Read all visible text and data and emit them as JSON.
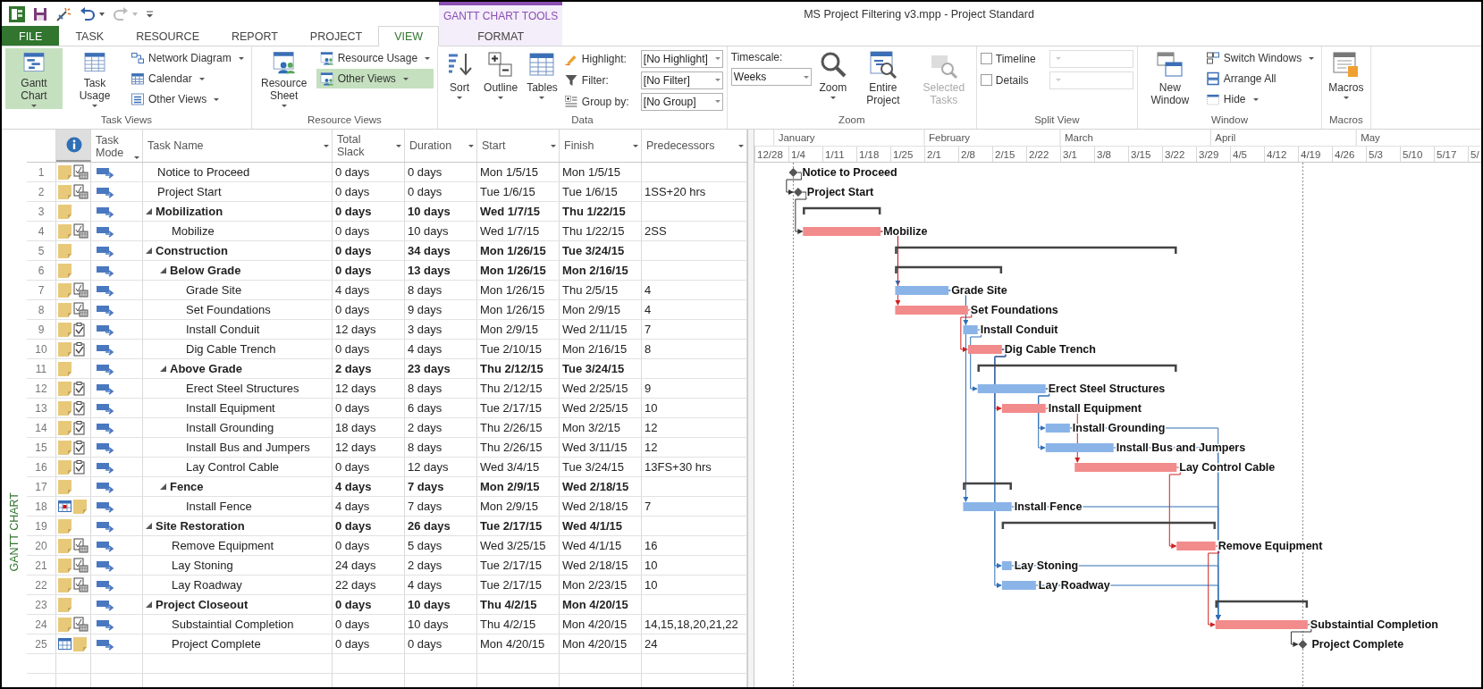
{
  "window": {
    "title": "MS Project Filtering v3.mpp - Project Standard"
  },
  "contextual_group": "GANTT CHART TOOLS",
  "tabs": [
    {
      "label": "FILE",
      "kind": "file",
      "selected": false
    },
    {
      "label": "TASK",
      "kind": "tab",
      "selected": false
    },
    {
      "label": "RESOURCE",
      "kind": "tab",
      "selected": false
    },
    {
      "label": "REPORT",
      "kind": "tab",
      "selected": false
    },
    {
      "label": "PROJECT",
      "kind": "tab",
      "selected": false
    },
    {
      "label": "VIEW",
      "kind": "tab",
      "selected": true
    },
    {
      "label": "FORMAT",
      "kind": "contextual",
      "selected": false
    }
  ],
  "ribbon": {
    "groups": [
      {
        "label": "Task Views",
        "items": [
          {
            "kind": "large",
            "label": "Gantt Chart",
            "dropdown": true,
            "selected": true
          },
          {
            "kind": "large",
            "label": "Task Usage",
            "dropdown": true,
            "selected": false
          },
          {
            "kind": "small",
            "label": "Network Diagram",
            "dropdown": true,
            "selected": false
          },
          {
            "kind": "small",
            "label": "Calendar",
            "dropdown": true,
            "selected": false
          },
          {
            "kind": "small",
            "label": "Other Views",
            "dropdown": true,
            "selected": false
          }
        ]
      },
      {
        "label": "Resource Views",
        "items": [
          {
            "kind": "large",
            "label": "Resource Sheet",
            "dropdown": true,
            "selected": false
          },
          {
            "kind": "small",
            "label": "Resource Usage",
            "dropdown": true,
            "selected": false
          },
          {
            "kind": "small",
            "label": "Other Views",
            "dropdown": true,
            "selected": true
          }
        ]
      },
      {
        "label": "Data",
        "items": [
          {
            "kind": "large",
            "label": "Sort",
            "dropdown": true
          },
          {
            "kind": "large",
            "label": "Outline",
            "dropdown": true
          },
          {
            "kind": "large",
            "label": "Tables",
            "dropdown": true
          },
          {
            "kind": "combo",
            "label": "Highlight:",
            "value": "[No Highlight]"
          },
          {
            "kind": "combo",
            "label": "Filter:",
            "value": "[No Filter]"
          },
          {
            "kind": "combo",
            "label": "Group by:",
            "value": "[No Group]"
          }
        ]
      },
      {
        "label": "Zoom",
        "items": [
          {
            "kind": "labeled-combo",
            "label": "Timescale:",
            "value": "Weeks",
            "disabled": false
          },
          {
            "kind": "large",
            "label": "Zoom",
            "dropdown": true,
            "disabled": false
          },
          {
            "kind": "large",
            "label": "Entire Project",
            "dropdown": false,
            "disabled": false
          },
          {
            "kind": "large",
            "label": "Selected Tasks",
            "dropdown": false,
            "disabled": true
          }
        ]
      },
      {
        "label": "Split View",
        "items": [
          {
            "kind": "checkbox",
            "label": "Timeline",
            "checked": false
          },
          {
            "kind": "checkbox",
            "label": "Details",
            "checked": false
          }
        ]
      },
      {
        "label": "Window",
        "items": [
          {
            "kind": "large",
            "label": "New Window",
            "dropdown": false
          },
          {
            "kind": "small",
            "label": "Switch Windows",
            "dropdown": true
          },
          {
            "kind": "small",
            "label": "Arrange All",
            "dropdown": false
          },
          {
            "kind": "small",
            "label": "Hide",
            "dropdown": true
          }
        ]
      },
      {
        "label": "Macros",
        "items": [
          {
            "kind": "large",
            "label": "Macros",
            "dropdown": true
          }
        ]
      }
    ]
  },
  "side_label": "GANTT CHART",
  "table": {
    "columns": [
      "Task Mode",
      "Task Name",
      "Total Slack",
      "Duration",
      "Start",
      "Finish",
      "Predecessors"
    ],
    "rows": [
      {
        "id": "1",
        "name": "Notice to Proceed",
        "kind": "milestone",
        "indicators": [
          {
            "kind": "note"
          },
          {
            "kind": "constraint-date"
          }
        ],
        "total_slack": "0 days",
        "duration": "0 days",
        "start": "Mon 1/5/15",
        "finish": "Mon 1/5/15",
        "bar_label": "Notice to Proceed"
      },
      {
        "id": "2",
        "name": "Project Start",
        "kind": "milestone",
        "indicators": [
          {
            "kind": "note"
          },
          {
            "kind": "constraint-date"
          }
        ],
        "total_slack": "0 days",
        "duration": "0 days",
        "start": "Tue 1/6/15",
        "finish": "Tue 1/6/15",
        "predecessors": "1SS+20 hrs",
        "bar_label": "Project Start"
      },
      {
        "id": "3",
        "name": "Mobilization",
        "kind": "summary",
        "indicators": [
          {
            "kind": "note"
          }
        ],
        "total_slack": "0 days",
        "duration": "10 days",
        "start": "Wed 1/7/15",
        "finish": "Thu 1/22/15",
        "children": [
          {
            "id": "4",
            "name": "Mobilize",
            "kind": "task",
            "critical": true,
            "indicators": [
              {
                "kind": "note"
              },
              {
                "kind": "constraint-date"
              }
            ],
            "total_slack": "0 days",
            "duration": "10 days",
            "start": "Wed 1/7/15",
            "finish": "Thu 1/22/15",
            "predecessors": "2SS",
            "bar_label": "Mobilize"
          }
        ]
      },
      {
        "id": "5",
        "name": "Construction",
        "kind": "summary",
        "indicators": [
          {
            "kind": "note"
          }
        ],
        "total_slack": "0 days",
        "duration": "34 days",
        "start": "Mon 1/26/15",
        "finish": "Tue 3/24/15",
        "children": [
          {
            "id": "6",
            "name": "Below Grade",
            "kind": "summary",
            "indicators": [
              {
                "kind": "note"
              }
            ],
            "total_slack": "0 days",
            "duration": "13 days",
            "start": "Mon 1/26/15",
            "finish": "Mon 2/16/15",
            "children": [
              {
                "id": "7",
                "name": "Grade Site",
                "kind": "task",
                "critical": false,
                "indicators": [
                  {
                    "kind": "note"
                  },
                  {
                    "kind": "constraint-date"
                  }
                ],
                "total_slack": "4 days",
                "duration": "8 days",
                "start": "Mon 1/26/15",
                "finish": "Thu 2/5/15",
                "predecessors": "4",
                "bar_label": "Grade Site"
              },
              {
                "id": "8",
                "name": "Set Foundations",
                "kind": "task",
                "critical": true,
                "indicators": [
                  {
                    "kind": "note"
                  },
                  {
                    "kind": "constraint-date"
                  }
                ],
                "total_slack": "0 days",
                "duration": "9 days",
                "start": "Mon 1/26/15",
                "finish": "Mon 2/9/15",
                "predecessors": "4",
                "bar_label": "Set Foundations"
              },
              {
                "id": "9",
                "name": "Install Conduit",
                "kind": "task",
                "critical": false,
                "indicators": [
                  {
                    "kind": "note"
                  },
                  {
                    "kind": "constraint"
                  }
                ],
                "total_slack": "12 days",
                "duration": "3 days",
                "start": "Mon 2/9/15",
                "finish": "Wed 2/11/15",
                "predecessors": "7",
                "bar_label": "Install Conduit"
              },
              {
                "id": "10",
                "name": "Dig Cable Trench",
                "kind": "task",
                "critical": true,
                "indicators": [
                  {
                    "kind": "note"
                  },
                  {
                    "kind": "constraint"
                  }
                ],
                "total_slack": "0 days",
                "duration": "4 days",
                "start": "Tue 2/10/15",
                "finish": "Mon 2/16/15",
                "predecessors": "8",
                "bar_label": "Dig Cable Trench"
              }
            ]
          },
          {
            "id": "11",
            "name": "Above Grade",
            "kind": "summary",
            "indicators": [
              {
                "kind": "note"
              }
            ],
            "total_slack": "2 days",
            "duration": "23 days",
            "start": "Thu 2/12/15",
            "finish": "Tue 3/24/15",
            "children": [
              {
                "id": "12",
                "name": "Erect Steel Structures",
                "kind": "task",
                "critical": false,
                "indicators": [
                  {
                    "kind": "note"
                  },
                  {
                    "kind": "constraint"
                  }
                ],
                "total_slack": "12 days",
                "duration": "8 days",
                "start": "Thu 2/12/15",
                "finish": "Wed 2/25/15",
                "predecessors": "9",
                "bar_label": "Erect Steel Structures"
              },
              {
                "id": "13",
                "name": "Install Equipment",
                "kind": "task",
                "critical": true,
                "indicators": [
                  {
                    "kind": "note"
                  },
                  {
                    "kind": "constraint"
                  }
                ],
                "total_slack": "0 days",
                "duration": "6 days",
                "start": "Tue 2/17/15",
                "finish": "Wed 2/25/15",
                "predecessors": "10",
                "bar_label": "Install Equipment"
              },
              {
                "id": "14",
                "name": "Install Grounding",
                "kind": "task",
                "critical": false,
                "indicators": [
                  {
                    "kind": "note"
                  },
                  {
                    "kind": "constraint"
                  }
                ],
                "total_slack": "18 days",
                "duration": "2 days",
                "start": "Thu 2/26/15",
                "finish": "Mon 3/2/15",
                "predecessors": "12",
                "bar_label": "Install Grounding"
              },
              {
                "id": "15",
                "name": "Install Bus and Jumpers",
                "kind": "task",
                "critical": false,
                "indicators": [
                  {
                    "kind": "note"
                  },
                  {
                    "kind": "constraint"
                  }
                ],
                "total_slack": "12 days",
                "duration": "8 days",
                "start": "Thu 2/26/15",
                "finish": "Wed 3/11/15",
                "predecessors": "12",
                "bar_label": "Install Bus and Jumpers"
              },
              {
                "id": "16",
                "name": "Lay Control Cable",
                "kind": "task",
                "critical": true,
                "indicators": [
                  {
                    "kind": "note"
                  },
                  {
                    "kind": "constraint"
                  }
                ],
                "total_slack": "0 days",
                "duration": "12 days",
                "start": "Wed 3/4/15",
                "finish": "Tue 3/24/15",
                "predecessors": "13FS+30 hrs",
                "bar_label": "Lay Control Cable"
              }
            ]
          },
          {
            "id": "17",
            "name": "Fence",
            "kind": "summary",
            "indicators": [
              {
                "kind": "note"
              }
            ],
            "total_slack": "4 days",
            "duration": "7 days",
            "start": "Mon 2/9/15",
            "finish": "Wed 2/18/15",
            "children": [
              {
                "id": "18",
                "name": "Install Fence",
                "kind": "task",
                "critical": false,
                "indicators": [
                  {
                    "kind": "calendar-alert"
                  },
                  {
                    "kind": "note"
                  }
                ],
                "total_slack": "4 days",
                "duration": "7 days",
                "start": "Mon 2/9/15",
                "finish": "Wed 2/18/15",
                "predecessors": "7",
                "bar_label": "Install Fence"
              }
            ]
          }
        ]
      },
      {
        "id": "19",
        "name": "Site Restoration",
        "kind": "summary",
        "indicators": [
          {
            "kind": "note"
          }
        ],
        "total_slack": "0 days",
        "duration": "26 days",
        "start": "Tue 2/17/15",
        "finish": "Wed 4/1/15",
        "children": [
          {
            "id": "20",
            "name": "Remove Equipment",
            "kind": "task",
            "critical": true,
            "indicators": [
              {
                "kind": "note"
              },
              {
                "kind": "constraint-date"
              }
            ],
            "total_slack": "0 days",
            "duration": "5 days",
            "start": "Wed 3/25/15",
            "finish": "Wed 4/1/15",
            "predecessors": "16",
            "bar_label": "Remove Equipment"
          },
          {
            "id": "21",
            "name": "Lay Stoning",
            "kind": "task",
            "critical": false,
            "indicators": [
              {
                "kind": "note"
              },
              {
                "kind": "constraint-date"
              }
            ],
            "total_slack": "24 days",
            "duration": "2 days",
            "start": "Tue 2/17/15",
            "finish": "Wed 2/18/15",
            "predecessors": "10",
            "bar_label": "Lay Stoning"
          },
          {
            "id": "22",
            "name": "Lay Roadway",
            "kind": "task",
            "critical": false,
            "indicators": [
              {
                "kind": "note"
              },
              {
                "kind": "constraint-date"
              }
            ],
            "total_slack": "22 days",
            "duration": "4 days",
            "start": "Tue 2/17/15",
            "finish": "Mon 2/23/15",
            "predecessors": "10",
            "bar_label": "Lay Roadway"
          }
        ]
      },
      {
        "id": "23",
        "name": "Project Closeout",
        "kind": "summary",
        "indicators": [
          {
            "kind": "note"
          }
        ],
        "total_slack": "0 days",
        "duration": "10 days",
        "start": "Thu 4/2/15",
        "finish": "Mon 4/20/15",
        "children": [
          {
            "id": "24",
            "name": "Substaintial Completion",
            "kind": "task",
            "critical": true,
            "indicators": [
              {
                "kind": "note"
              },
              {
                "kind": "constraint-date"
              }
            ],
            "total_slack": "0 days",
            "duration": "10 days",
            "start": "Thu 4/2/15",
            "finish": "Mon 4/20/15",
            "predecessors": "14,15,18,20,21,22",
            "bar_label": "Substaintial Completion"
          },
          {
            "id": "25",
            "name": "Project Complete",
            "kind": "milestone",
            "indicators": [
              {
                "kind": "calendar"
              },
              {
                "kind": "note"
              }
            ],
            "total_slack": "0 days",
            "duration": "0 days",
            "start": "Mon 4/20/15",
            "finish": "Mon 4/20/15",
            "predecessors": "24",
            "bar_label": "Project Complete"
          }
        ]
      }
    ]
  },
  "gantt": {
    "timescale": {
      "months": [
        "January",
        "February",
        "March",
        "April",
        "May"
      ],
      "weeks": [
        "12/28",
        "1/4",
        "1/11",
        "1/18",
        "1/25",
        "2/1",
        "2/8",
        "2/15",
        "2/22",
        "3/1",
        "3/8",
        "3/15",
        "3/22",
        "3/29",
        "4/5",
        "4/12",
        "4/19",
        "4/26",
        "5/3",
        "5/10",
        "5/17",
        "5/"
      ]
    }
  }
}
